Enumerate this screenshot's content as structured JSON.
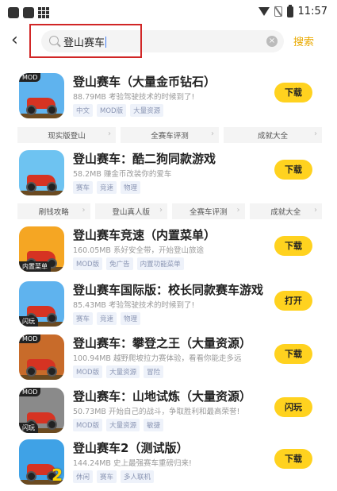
{
  "status_bar": {
    "time": "11:57"
  },
  "search": {
    "query": "登山赛车",
    "button": "搜索"
  },
  "results": [
    {
      "title": "登山赛车（大量金币钻石）",
      "size": "88.79MB",
      "desc": "考验驾驶技术的时候到了!",
      "tags": [
        "中文",
        "MOD版",
        "大量资源"
      ],
      "button": "下载",
      "badge_tl": "MOD",
      "icon_bg": "#5fb3ee"
    },
    {
      "title": "登山赛车：酷二狗同款游戏",
      "size": "58.2MB",
      "desc": "赚金币改装你的爱车",
      "tags": [
        "赛车",
        "竞速",
        "物理"
      ],
      "button": "下载",
      "icon_bg": "#6ec3f1"
    },
    {
      "title": "登山赛车竞速（内置菜单）",
      "size": "160.05MB",
      "desc": "系好安全带，开始登山旅途",
      "tags": [
        "MOD版",
        "免广告",
        "内置功能菜单"
      ],
      "button": "下载",
      "badge_bl": "内置菜单",
      "icon_bg": "#f5a623"
    },
    {
      "title": "登山赛车国际版：校长同款赛车游戏",
      "size": "85.43MB",
      "desc": "考验驾驶技术的时候到了!",
      "tags": [
        "赛车",
        "竞速",
        "物理"
      ],
      "button": "打开",
      "badge_bl": "闪玩",
      "icon_bg": "#5fb3ee"
    },
    {
      "title": "登山赛车：攀登之王（大量资源）",
      "size": "100.94MB",
      "desc": "越野爬坡拉力赛体验，看看你能走多远",
      "tags": [
        "MOD版",
        "大量资源",
        "冒险"
      ],
      "button": "下载",
      "badge_tl": "MOD",
      "icon_bg": "#c86b2a"
    },
    {
      "title": "登山赛车：山地试炼（大量资源）",
      "size": "50.73MB",
      "desc": "开始自己的战斗，争取胜利和最高荣誉!",
      "tags": [
        "MOD版",
        "大量资源",
        "敏捷"
      ],
      "button": "闪玩",
      "badge_tl": "MOD",
      "badge_bl": "闪玩",
      "icon_bg": "#8a8a8a"
    },
    {
      "title": "登山赛车2（测试版）",
      "size": "144.24MB",
      "desc": "史上最强赛车重磅归来!",
      "tags": [
        "休闲",
        "赛车",
        "多人联机"
      ],
      "button": "下载",
      "badge_br": "2",
      "icon_bg": "#3fa2e6"
    }
  ],
  "chip_rows": [
    [
      "现实版登山",
      "全赛车评测",
      "成就大全"
    ],
    [
      "刷钱攻略",
      "登山真人版",
      "全赛车评测",
      "成就大全"
    ]
  ],
  "colors": {
    "accent": "#ffd21f",
    "search_accent": "#e9a900",
    "highlight": "#d12626"
  }
}
